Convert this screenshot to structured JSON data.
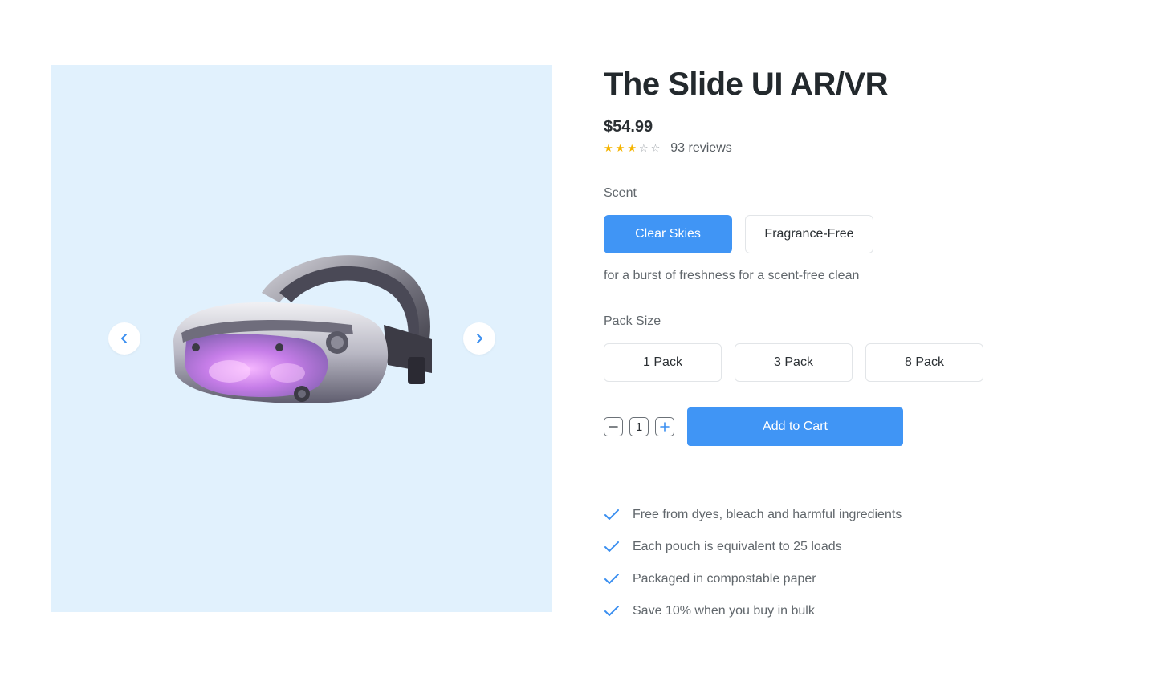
{
  "product": {
    "title": "The Slide UI AR/VR",
    "price": "$54.99",
    "rating": {
      "value": 3,
      "max": 5,
      "reviews_text": "93 reviews"
    }
  },
  "gallery": {
    "prev_icon": "chevron-left-icon",
    "next_icon": "chevron-right-icon",
    "image_subject": "VR headset"
  },
  "scent": {
    "label": "Scent",
    "options": [
      "Clear Skies",
      "Fragrance-Free"
    ],
    "selected": "Clear Skies",
    "description": "for a burst of freshness for a scent-free clean"
  },
  "pack_size": {
    "label": "Pack Size",
    "options": [
      "1 Pack",
      "3 Pack",
      "8 Pack"
    ]
  },
  "quantity": {
    "value": "1",
    "decrement_icon": "minus-icon",
    "increment_icon": "plus-icon"
  },
  "cart": {
    "label": "Add to Cart"
  },
  "features": [
    "Free from dyes, bleach and harmful ingredients",
    "Each pouch is equivalent to 25 loads",
    "Packaged in compostable paper",
    "Save 10% when you buy in bulk"
  ],
  "colors": {
    "accent": "#4095f5",
    "gallery_bg": "#e1f1fd",
    "star": "#f5b400",
    "check": "#3b8ff0"
  }
}
